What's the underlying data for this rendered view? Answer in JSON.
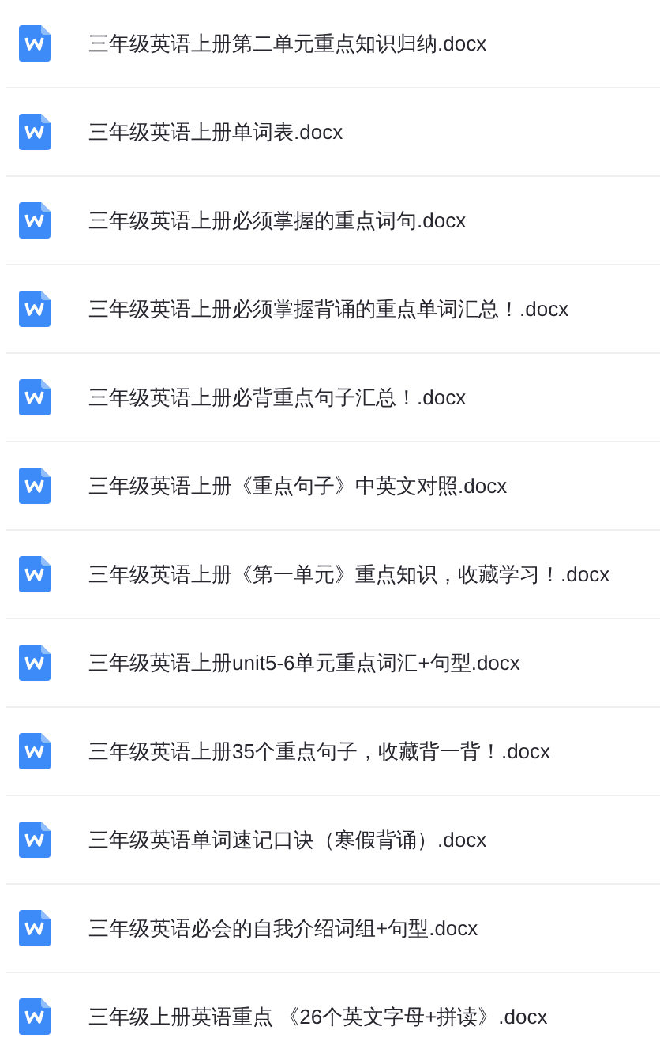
{
  "files": [
    {
      "name": "三年级英语上册第二单元重点知识归纳.docx"
    },
    {
      "name": "三年级英语上册单词表.docx"
    },
    {
      "name": "三年级英语上册必须掌握的重点词句.docx"
    },
    {
      "name": "三年级英语上册必须掌握背诵的重点单词汇总！.docx"
    },
    {
      "name": "三年级英语上册必背重点句子汇总！.docx"
    },
    {
      "name": "三年级英语上册《重点句子》中英文对照.docx"
    },
    {
      "name": "三年级英语上册《第一单元》重点知识，收藏学习！.docx"
    },
    {
      "name": "三年级英语上册unit5-6单元重点词汇+句型.docx"
    },
    {
      "name": "三年级英语上册35个重点句子，收藏背一背！.docx"
    },
    {
      "name": "三年级英语单词速记口诀（寒假背诵）.docx"
    },
    {
      "name": "三年级英语必会的自我介绍词组+句型.docx"
    },
    {
      "name": "三年级上册英语重点 《26个英文字母+拼读》.docx"
    }
  ]
}
